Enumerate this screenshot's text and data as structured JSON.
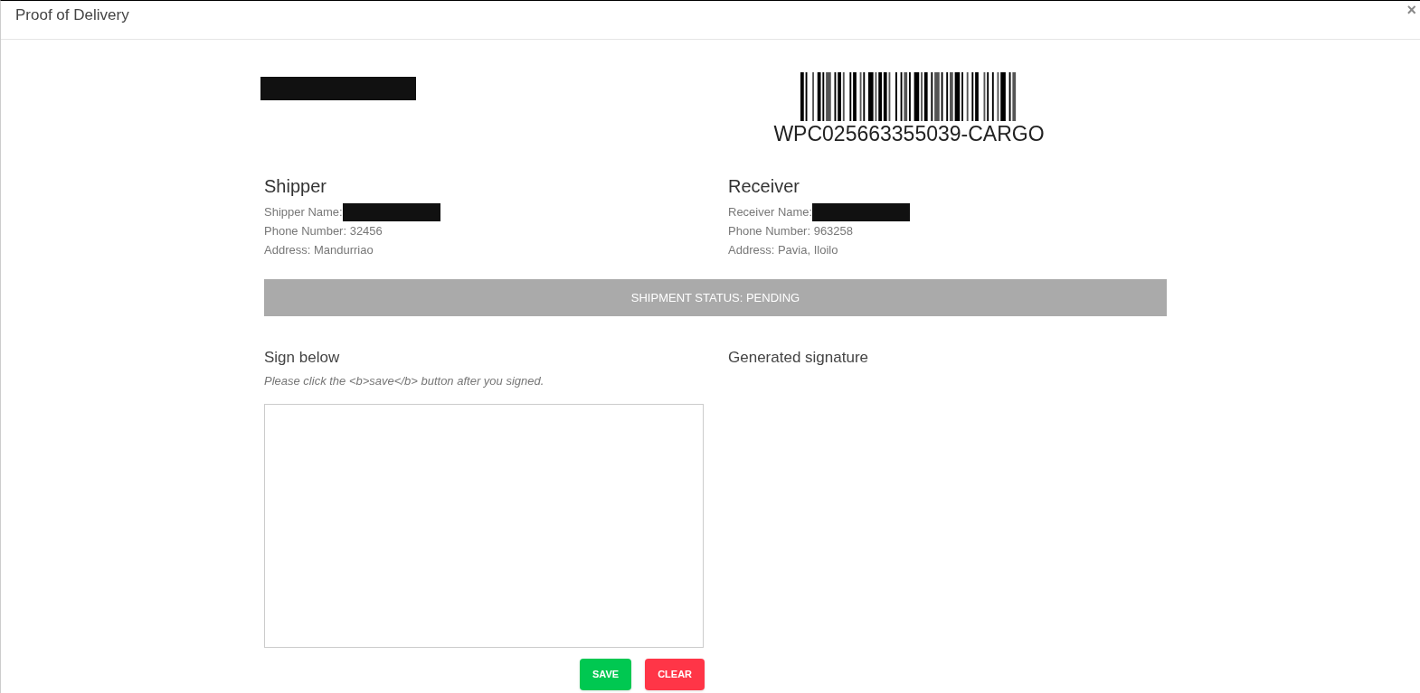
{
  "window": {
    "title": "Proof of Delivery",
    "close": "×"
  },
  "barcode": {
    "number": "WPC025663355039-CARGO"
  },
  "shipper": {
    "heading": "Shipper",
    "name_label": "Shipper Name:",
    "phone": "Phone Number: 32456",
    "address": "Address: Mandurriao"
  },
  "receiver": {
    "heading": "Receiver",
    "name_label": "Receiver Name:",
    "phone": "Phone Number: 963258",
    "address": "Address: Pavia, Iloilo"
  },
  "status_bar": "SHIPMENT STATUS: PENDING",
  "sign": {
    "heading": "Sign below",
    "instruction": "Please click the <b>save</b> button after you signed."
  },
  "generated": {
    "heading": "Generated signature"
  },
  "buttons": [
    {
      "label": "SAVE",
      "kind": "save"
    },
    {
      "label": "CLEAR",
      "kind": "clear"
    }
  ]
}
